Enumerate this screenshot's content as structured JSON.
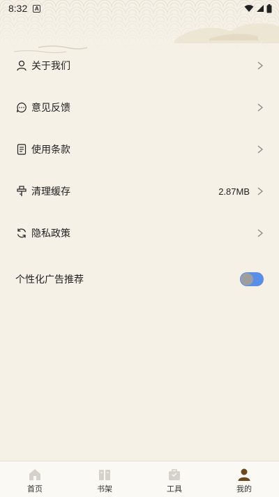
{
  "status_bar": {
    "time": "8:32",
    "notification_glyph": "A"
  },
  "menu": {
    "items": [
      {
        "label": "关于我们",
        "icon": "person-icon"
      },
      {
        "label": "意见反馈",
        "icon": "chat-bubble-icon"
      },
      {
        "label": "使用条款",
        "icon": "document-icon"
      },
      {
        "label": "清理缓存",
        "icon": "broom-icon",
        "value": "2.87MB"
      },
      {
        "label": "隐私政策",
        "icon": "refresh-icon"
      }
    ],
    "ad_toggle": {
      "label": "个性化广告推荐",
      "on": true
    }
  },
  "tabbar": {
    "tabs": [
      {
        "label": "首页",
        "icon": "home-icon"
      },
      {
        "label": "书架",
        "icon": "bookshelf-icon"
      },
      {
        "label": "工具",
        "icon": "toolbox-icon"
      },
      {
        "label": "我的",
        "icon": "profile-icon",
        "active": true
      }
    ]
  },
  "colors": {
    "background": "#f6f1e7",
    "toggle_track": "#5a8de6",
    "toggle_knob": "#9e9e9e",
    "active_tab": "#6b4a1f",
    "inactive_tab": "#d6d2cb"
  }
}
